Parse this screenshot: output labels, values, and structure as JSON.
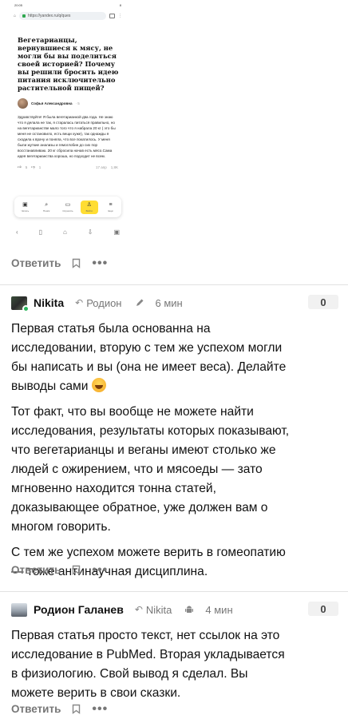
{
  "phone": {
    "status": {
      "time": "20:05",
      "right": "8"
    },
    "url": "https://yandex.ru/q/ques",
    "tabs_count": "1",
    "question_title": "Вегетарианцы, вернувшиеся к мясу, не могли бы вы поделиться своей историей? Почему вы решили бросить идею питания исключительно растительной пищей?",
    "author_name": "Софья Александровна",
    "author_meta": "· 5",
    "answer_text": "Здравствуйте! Я была вегетарианкой два года. Не знаю что я делала не так, я старалась питаться правильно, но на вегетарианстве мало того что я набрала 20 кг ( это бы меня не остановило, есть вещи хуже), так однажды я сходила к врачу и поняла, что все покатилось. У меня были жуткие анализы и гемоглобин до сих пор восстанавливаю. 20 кг сбросила начав есть мясо.Сама идея вегетарианства хороша, но подходит не всем.",
    "likes": "5",
    "dislikes": "1",
    "date": "17 апр",
    "views": "1,8K",
    "nav": [
      {
        "icon": "home-icon",
        "glyph": "▣",
        "label": "Читать"
      },
      {
        "icon": "search-icon",
        "glyph": "⌕",
        "label": "Поиск"
      },
      {
        "icon": "ask-icon",
        "glyph": "▭",
        "label": "Спросить"
      },
      {
        "icon": "profile-icon",
        "glyph": "♙",
        "label": "Войти"
      },
      {
        "icon": "menu-icon",
        "glyph": "≡",
        "label": "Ещё"
      }
    ],
    "sysbar": [
      "‹",
      "▯",
      "⌂",
      "⇩",
      "▣"
    ]
  },
  "actions": {
    "reply": "Ответить",
    "more": "•••"
  },
  "comments": [
    {
      "author": "Nikita",
      "reply_to": "Родион",
      "time": "6 мин",
      "votes": "0",
      "paragraphs": [
        "Первая статья была основанна на исследовании, вторую с тем же успехом могли бы написать и вы (она не имеет веса). Делайте выводы сами",
        "Тот факт, что вы вообще не можете найти исследования, результаты которых показывают, что вегетарианцы и веганы имеют столько же людей с ожирением, что и мясоеды — зато мгновенно находится тонна статей, доказывающее обратное, уже должен вам о многом говорить.",
        "С тем же успехом можете верить в гомеопатию — тоже антинаучная дисциплина."
      ]
    },
    {
      "author": "Родион Галанев",
      "reply_to": "Nikita",
      "time": "4 мин",
      "votes": "0",
      "paragraphs": [
        "Первая статья просто текст, нет ссылок на это исследование в PubMed. Вторая укладывается в физиологию. Свой вывод я сделал. Вы можете верить в свои сказки."
      ]
    }
  ]
}
